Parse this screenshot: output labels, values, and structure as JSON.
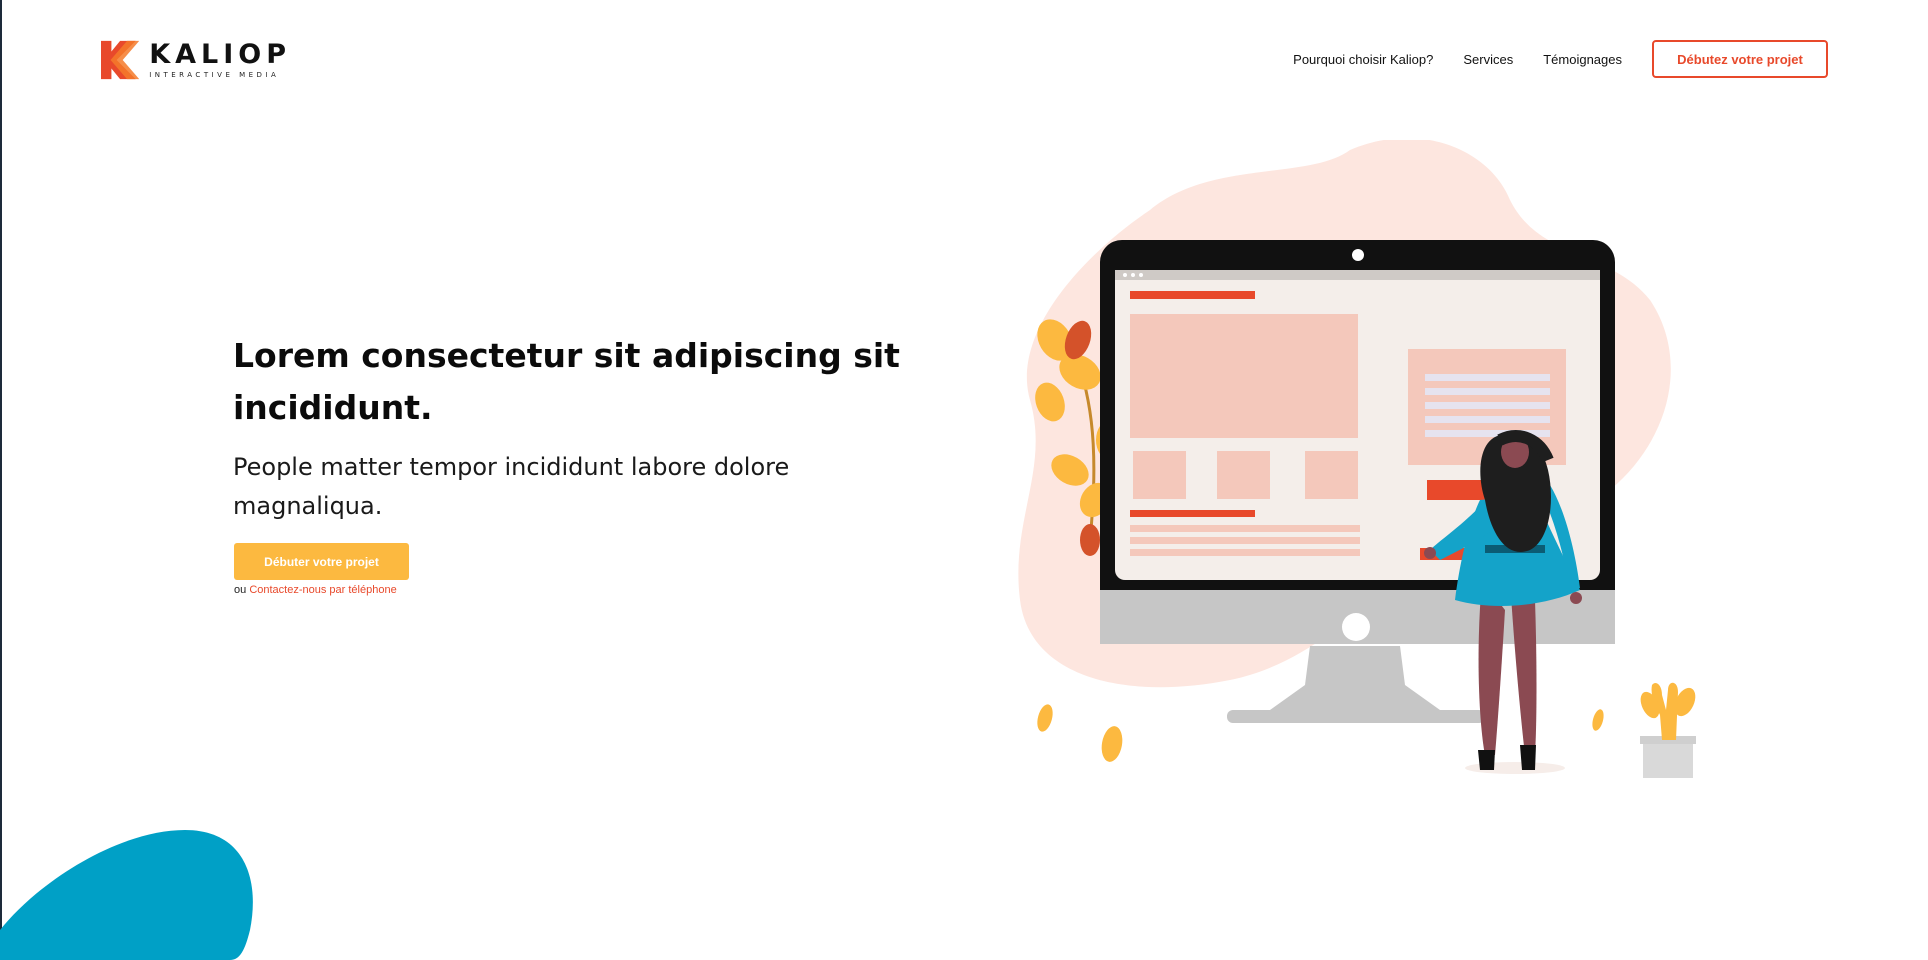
{
  "header": {
    "logo": {
      "name": "KALIOP",
      "tagline": "INTERACTIVE MEDIA",
      "icon": "kaliop-k-icon"
    },
    "nav": {
      "items": [
        {
          "label": "Pourquoi choisir Kaliop?"
        },
        {
          "label": "Services"
        },
        {
          "label": "Témoignages"
        }
      ],
      "cta_label": "Débutez votre projet"
    }
  },
  "hero": {
    "title": "Lorem consectetur sit adipiscing sit incididunt.",
    "subtitle": "People matter tempor incididunt labore dolore magnaliqua.",
    "button_label": "Débuter votre projet",
    "alt_prefix": "ou",
    "alt_link": "Contactez-nous par téléphone"
  },
  "illustration": {
    "icon": "woman-at-computer-illustration"
  },
  "colors": {
    "brand_orange": "#e8492b",
    "cta_yellow": "#fcb940",
    "blob_blue": "#00a0c6",
    "blob_pink": "#fde6df"
  }
}
